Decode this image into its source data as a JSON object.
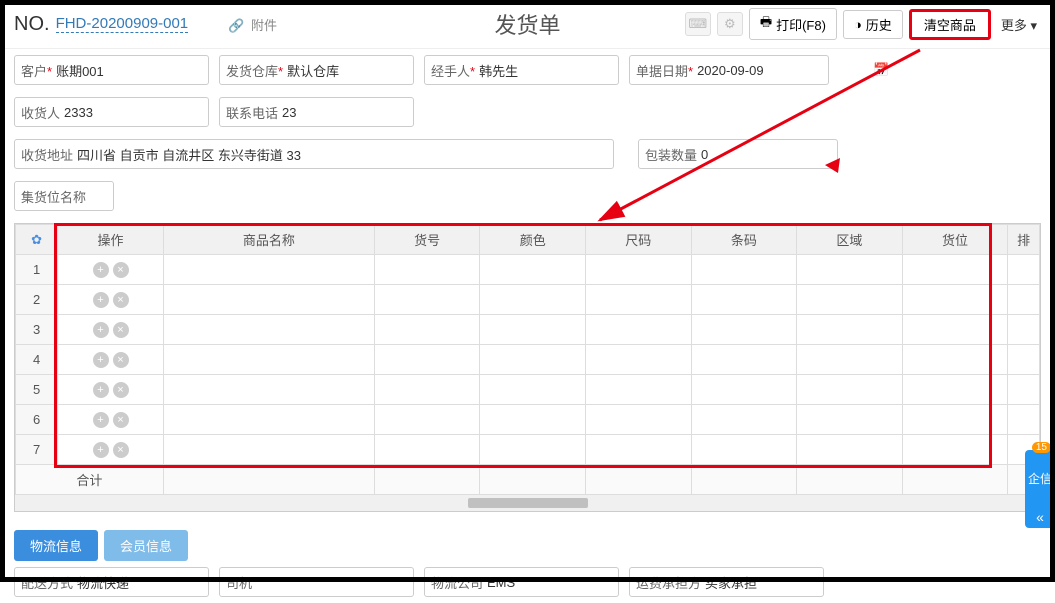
{
  "header": {
    "no_label": "NO.",
    "no_value": "FHD-20200909-001",
    "attach_label": "附件",
    "title": "发货单",
    "print_label": "打印(F8)",
    "history_label": "历史",
    "clear_label": "清空商品",
    "more_label": "更多"
  },
  "form": {
    "customer": {
      "label": "客户",
      "value": "账期001",
      "badge": "详"
    },
    "warehouse": {
      "label": "发货仓库",
      "value": "默认仓库"
    },
    "handler": {
      "label": "经手人",
      "value": "韩先生"
    },
    "date": {
      "label": "单据日期",
      "value": "2020-09-09"
    },
    "receiver": {
      "label": "收货人",
      "value": "2333"
    },
    "phone": {
      "label": "联系电话",
      "value": "23"
    },
    "address": {
      "label": "收货地址",
      "value": "四川省 自贡市 自流井区 东兴寺街道 33"
    },
    "pkgqty": {
      "label": "包装数量",
      "value": "0"
    },
    "slot": {
      "label": "集货位名称",
      "value": ""
    }
  },
  "table": {
    "cols": [
      "操作",
      "商品名称",
      "货号",
      "颜色",
      "尺码",
      "条码",
      "区域",
      "货位"
    ],
    "extra_col": "排",
    "row_count": 7,
    "total_label": "合计"
  },
  "tabs": {
    "logistics": "物流信息",
    "member": "会员信息"
  },
  "bottom": {
    "ship_method": {
      "label": "配送方式",
      "value": "物流快递"
    },
    "driver": {
      "label": "司机",
      "value": ""
    },
    "ship_company": {
      "label": "物流公司",
      "value": "EMS"
    },
    "freight_bearer": {
      "label": "运费承担方",
      "value": "买家承担"
    }
  },
  "side": {
    "badge": "15",
    "label": "企信"
  }
}
